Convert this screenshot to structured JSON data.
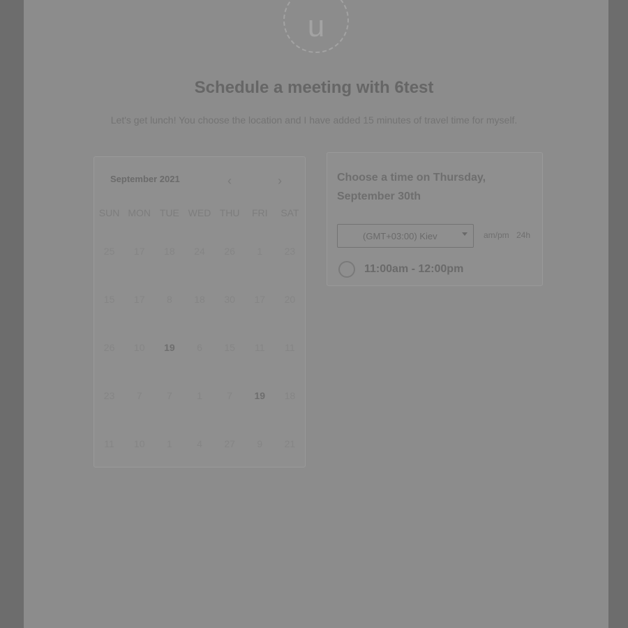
{
  "avatar": {
    "letter": "u"
  },
  "heading": {
    "title": "Schedule a meeting with 6test",
    "subtitle": "Let's get lunch! You choose the location and I have added 15 minutes of travel time for myself."
  },
  "calendar": {
    "month_label": "September 2021",
    "prev_icon": "chevron-left-icon",
    "next_icon": "chevron-right-icon",
    "weekdays": [
      "SUN",
      "MON",
      "TUE",
      "WED",
      "THU",
      "FRI",
      "SAT"
    ],
    "weeks": [
      [
        {
          "d": "25"
        },
        {
          "d": "17"
        },
        {
          "d": "18"
        },
        {
          "d": "24"
        },
        {
          "d": "26"
        },
        {
          "d": "1"
        },
        {
          "d": "23"
        }
      ],
      [
        {
          "d": "15"
        },
        {
          "d": "17"
        },
        {
          "d": "8"
        },
        {
          "d": "18"
        },
        {
          "d": "30"
        },
        {
          "d": "17"
        },
        {
          "d": "20"
        }
      ],
      [
        {
          "d": "26"
        },
        {
          "d": "10"
        },
        {
          "d": "19",
          "available": true
        },
        {
          "d": "6"
        },
        {
          "d": "15"
        },
        {
          "d": "11"
        },
        {
          "d": "11"
        }
      ],
      [
        {
          "d": "23"
        },
        {
          "d": "7"
        },
        {
          "d": "7"
        },
        {
          "d": "1"
        },
        {
          "d": "7"
        },
        {
          "d": "19",
          "available": true
        },
        {
          "d": "18"
        }
      ],
      [
        {
          "d": "11"
        },
        {
          "d": "10"
        },
        {
          "d": "1"
        },
        {
          "d": "4"
        },
        {
          "d": "27"
        },
        {
          "d": "9"
        },
        {
          "d": "21"
        }
      ]
    ]
  },
  "times": {
    "heading": "Choose a time on Thursday, September 30th",
    "timezone": "(GMT+03:00) Kiev",
    "format_ampm": "am/pm",
    "format_24h": "24h",
    "slots": [
      {
        "label": "11:00am - 12:00pm"
      }
    ]
  }
}
